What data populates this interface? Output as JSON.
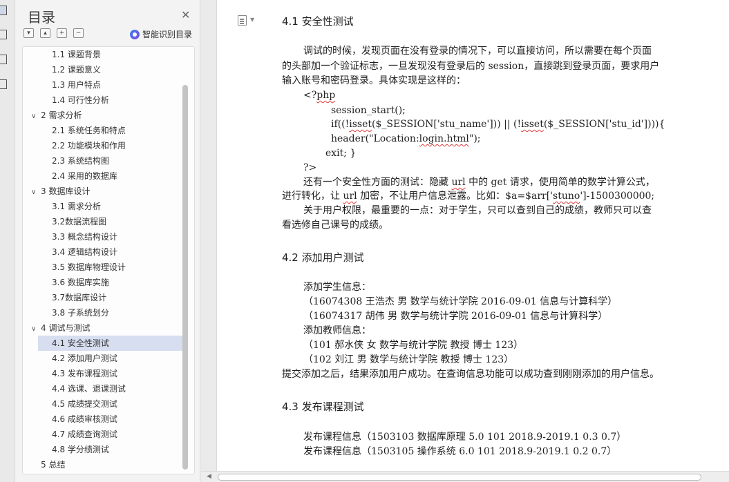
{
  "toc": {
    "title": "目录",
    "smart_label": "智能识别目录",
    "items": [
      {
        "label": "1.1 课题背景",
        "level": 2
      },
      {
        "label": "1.2 课题意义",
        "level": 2
      },
      {
        "label": "1.3 用户特点",
        "level": 2
      },
      {
        "label": "1.4 可行性分析",
        "level": 2
      },
      {
        "label": "2 需求分析",
        "level": 1,
        "expanded": true
      },
      {
        "label": "2.1 系统任务和特点",
        "level": 2
      },
      {
        "label": "2.2 功能模块和作用",
        "level": 2
      },
      {
        "label": "2.3 系统结构图",
        "level": 2
      },
      {
        "label": "2.4 采用的数据库",
        "level": 2
      },
      {
        "label": "3 数据库设计",
        "level": 1,
        "expanded": true
      },
      {
        "label": "3.1 需求分析",
        "level": 2
      },
      {
        "label": "3.2数据流程图",
        "level": 2
      },
      {
        "label": "3.3 概念结构设计",
        "level": 2
      },
      {
        "label": "3.4 逻辑结构设计",
        "level": 2
      },
      {
        "label": "3.5 数据库物理设计",
        "level": 2
      },
      {
        "label": "3.6 数据库实施",
        "level": 2
      },
      {
        "label": "3.7数据库设计",
        "level": 2
      },
      {
        "label": "3.8 子系统划分",
        "level": 2
      },
      {
        "label": "4 调试与测试",
        "level": 1,
        "expanded": true
      },
      {
        "label": "4.1 安全性测试",
        "level": 2,
        "selected": true
      },
      {
        "label": "4.2 添加用户测试",
        "level": 2
      },
      {
        "label": "4.3 发布课程测试",
        "level": 2
      },
      {
        "label": "4.4 选课、退课测试",
        "level": 2
      },
      {
        "label": "4.5 成绩提交测试",
        "level": 2
      },
      {
        "label": "4.6 成绩审核测试",
        "level": 2
      },
      {
        "label": "4.7 成绩查询测试",
        "level": 2
      },
      {
        "label": "4.8 学分绩测试",
        "level": 2
      },
      {
        "label": "5 总结",
        "level": 1
      }
    ]
  },
  "doc": {
    "h41": "4.1  安全性测试",
    "p1": [
      "调试的时候，发现页面在没有登录的情况下，可以直接访问，所以需要在每个页面",
      "的头部加一个验证标志，一旦发现没有登录后的 session，直接跳到登录页面，要求用户",
      "输入账号和密码登录。具体实现是这样的："
    ],
    "code": {
      "open_pre": "<?",
      "open_kw": "php",
      "l1": "session_start();",
      "l2_a": "if((!",
      "l2_b": "isset",
      "l2_c": "($_SESSION['stu_name'])) || (!",
      "l2_d": "isset",
      "l2_e": "($_SESSION['stu_id']))){",
      "l3_a": "header(\"Location:",
      "l3_b": "login.html",
      "l3_c": "\");",
      "l4": "exit; }",
      "close": "?>"
    },
    "p2_1a": "还有一个安全性方面的测试：隐藏 ",
    "p2_1b": "url",
    "p2_1c": " 中的 get 请求，使用简单的数学计算公式，",
    "p2_2a": "进行转化，让 ",
    "p2_2b": "url",
    "p2_2c": " 加密，不让用户信息泄露。比如：$a=$arr['",
    "p2_2d": "stuno",
    "p2_2e": "']-1500300000;",
    "p3": [
      "关于用户权限，最重要的一点：对于学生，只可以查到自己的成绩，教师只可以查",
      "看选修自己课号的成绩。"
    ],
    "h42": "4.2  添加用户测试",
    "s42": [
      "添加学生信息：",
      "（16074308  王浩杰  男  数学与统计学院  2016-09-01  信息与计算科学）",
      "（16074317  胡伟  男  数学与统计学院  2016-09-01  信息与计算科学）",
      "添加教师信息：",
      "（101  郝水侠  女  数学与统计学院  教授  博士  123）",
      "（102  刘江  男  数学与统计学院  教授  博士  123）"
    ],
    "s42_after": "提交添加之后，结果添加用户成功。在查询信息功能可以成功查到刚刚添加的用户信息。",
    "h43": "4.3  发布课程测试",
    "s43": [
      "发布课程信息（1503103  数据库原理  5.0 101 2018.9-2019.1 0.3 0.7）",
      "发布课程信息（1503105  操作系统 6.0 101 2018.9-2019.1 0.2 0.7）"
    ]
  }
}
